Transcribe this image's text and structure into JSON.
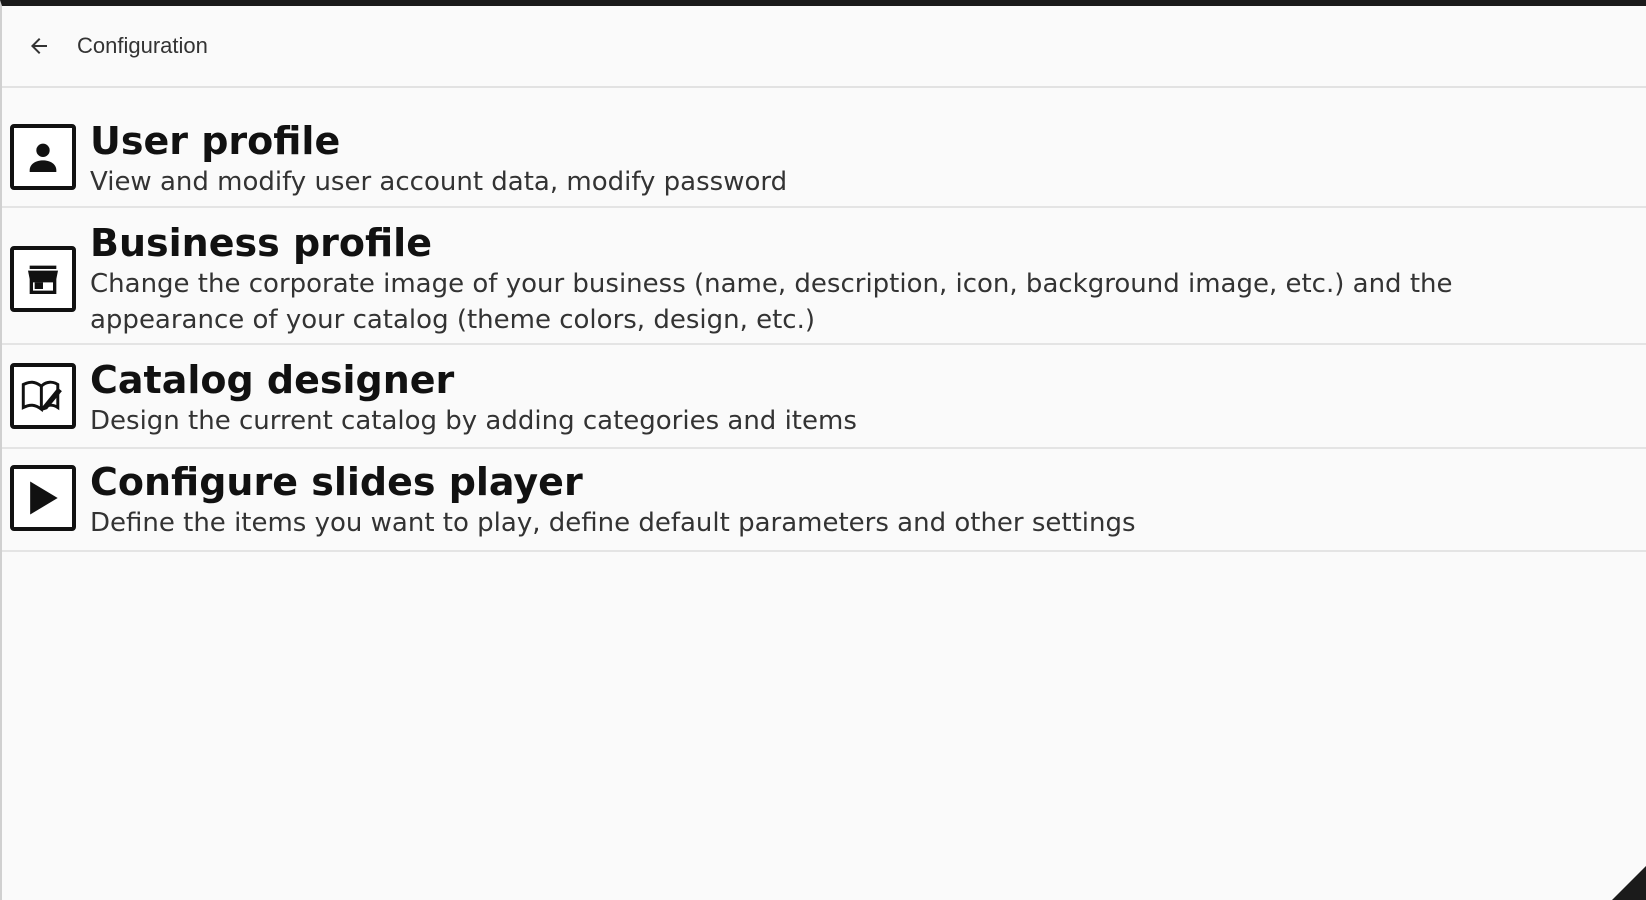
{
  "toolbar": {
    "back_icon": "arrow-back-icon",
    "title": "Configuration"
  },
  "items": [
    {
      "icon": "user-icon",
      "title": "User profile",
      "description": "View and modify user account data, modify password"
    },
    {
      "icon": "store-icon",
      "title": "Business profile",
      "description": "Change the corporate image of your business (name, description, icon, background image, etc.) and the appearance of your catalog (theme colors, design, etc.)"
    },
    {
      "icon": "book-edit-icon",
      "title": "Catalog designer",
      "description": "Design the current catalog by adding categories and items"
    },
    {
      "icon": "play-icon",
      "title": "Configure slides player",
      "description": "Define the items you want to play, define default parameters and other settings"
    }
  ],
  "colors": {
    "background": "#fafafa",
    "text": "#111111",
    "divider": "#e4e4e4"
  }
}
